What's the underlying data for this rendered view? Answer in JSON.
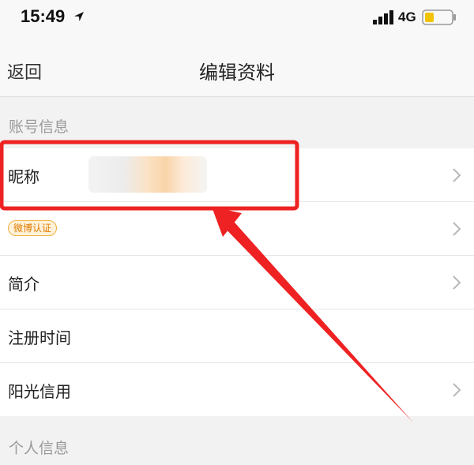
{
  "status_bar": {
    "time": "15:49",
    "network": "4G",
    "icons": [
      "location-arrow-icon",
      "signal-icon",
      "battery-icon"
    ],
    "battery_color": "#f2c400"
  },
  "nav": {
    "back_label": "返回",
    "title": "编辑资料"
  },
  "sections": {
    "account": {
      "header": "账号信息",
      "rows": [
        {
          "label": "昵称",
          "has_chevron": true
        },
        {
          "badge": "微博认证",
          "has_chevron": true
        },
        {
          "label": "简介",
          "has_chevron": true
        },
        {
          "label": "注册时间",
          "has_chevron": false
        },
        {
          "label": "阳光信用",
          "has_chevron": true
        }
      ]
    },
    "personal": {
      "header": "个人信息"
    }
  },
  "annotation": {
    "highlight_color": "#ee2222"
  }
}
